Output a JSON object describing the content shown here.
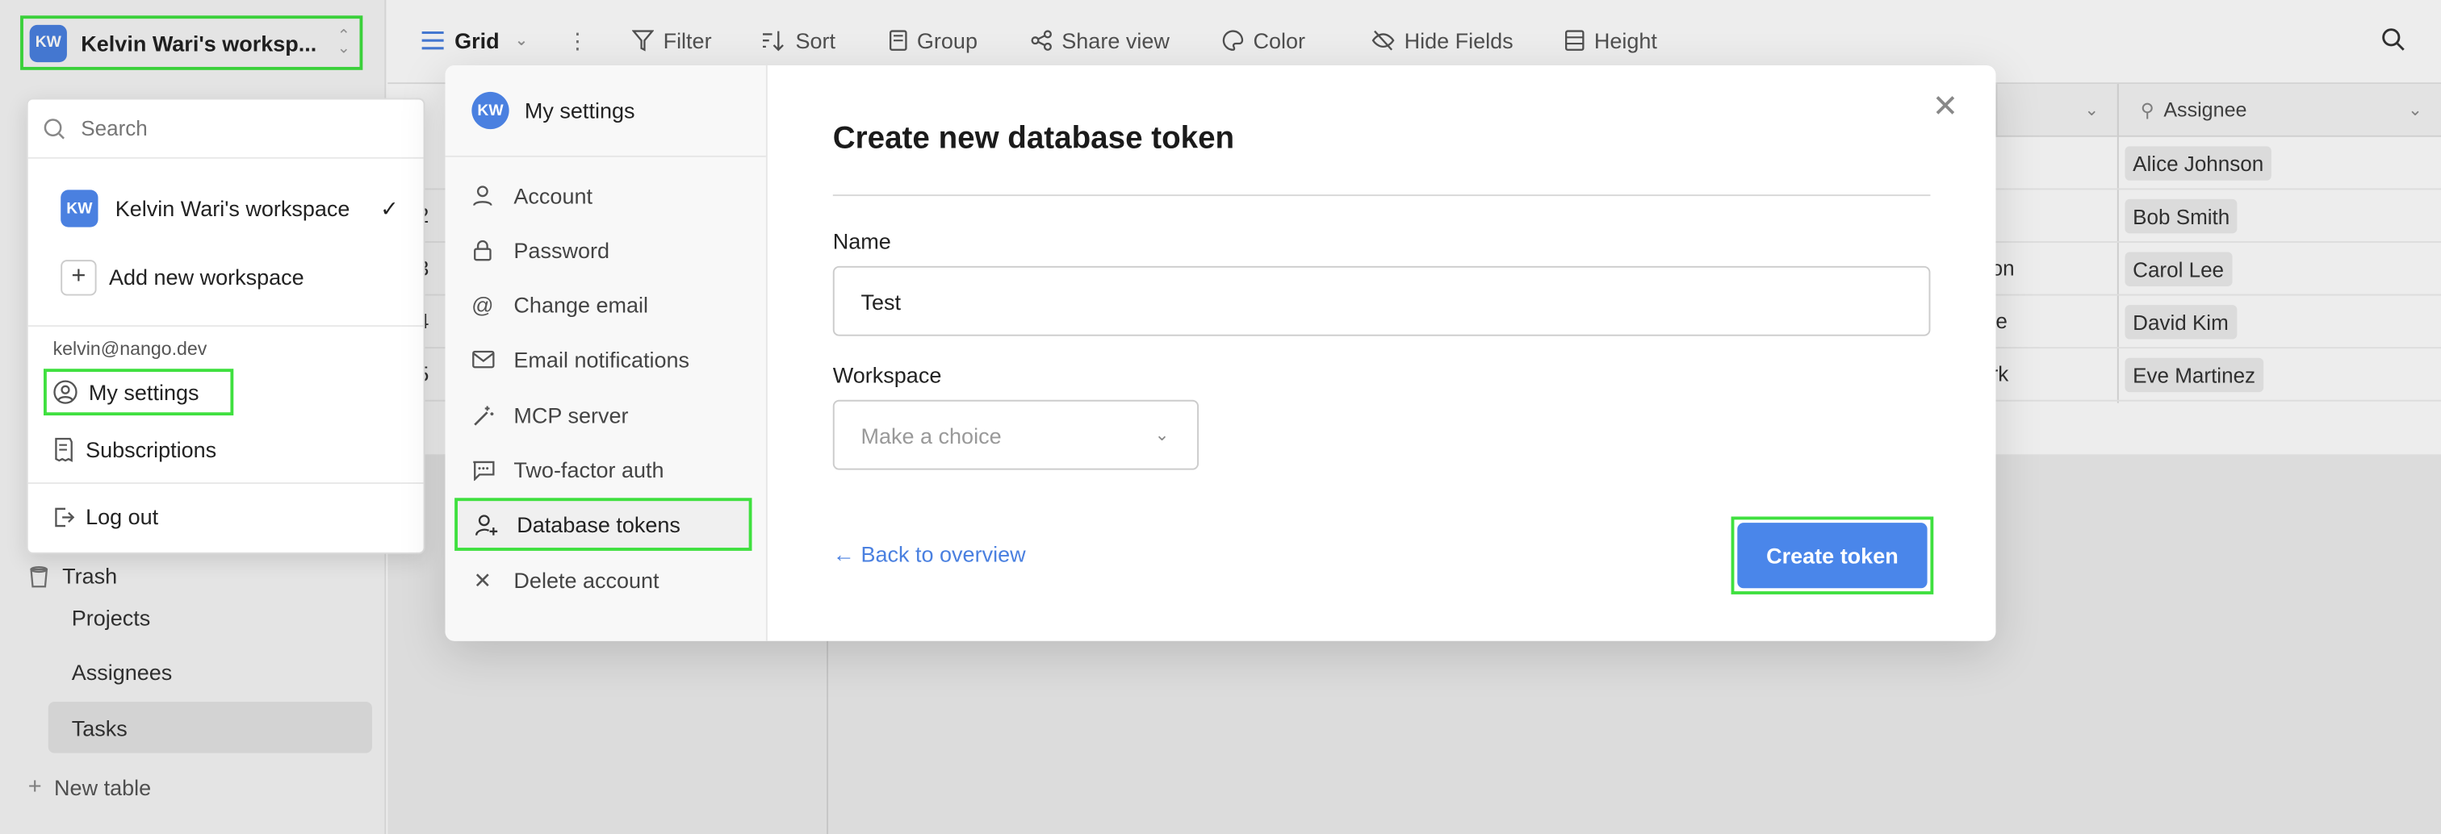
{
  "workspace_switcher": {
    "avatar": "KW",
    "name": "Kelvin Wari's worksp..."
  },
  "toolbar": {
    "view": "Grid",
    "items": [
      "Filter",
      "Sort",
      "Group",
      "Share view",
      "Color",
      "Hide Fields",
      "Height"
    ]
  },
  "grid": {
    "assignee_header": "Assignee",
    "row_numbers": [
      "2",
      "3",
      "4",
      "5"
    ],
    "assignees": [
      "Alice Johnson",
      "Bob Smith",
      "Carol Lee",
      "David Kim",
      "Eve Martinez"
    ],
    "partial_cells": [
      "on",
      "le",
      "rk"
    ]
  },
  "sidebar": {
    "trash": "Trash",
    "tables": [
      "Projects",
      "Assignees",
      "Tasks"
    ],
    "new_table": "New table"
  },
  "dropdown": {
    "search_placeholder": "Search",
    "workspace_avatar": "KW",
    "workspace_name": "Kelvin Wari's workspace",
    "add_workspace": "Add new workspace",
    "email": "kelvin@nango.dev",
    "my_settings": "My settings",
    "subscriptions": "Subscriptions",
    "log_out": "Log out"
  },
  "settings_modal": {
    "avatar": "KW",
    "header": "My settings",
    "menu": [
      "Account",
      "Password",
      "Change email",
      "Email notifications",
      "MCP server",
      "Two-factor auth",
      "Database tokens",
      "Delete account"
    ],
    "title": "Create new database token",
    "name_label": "Name",
    "name_value": "Test",
    "workspace_label": "Workspace",
    "workspace_placeholder": "Make a choice",
    "back_link": "Back to overview",
    "create_button": "Create token"
  },
  "colors": {
    "accent": "#4a86ea",
    "highlight": "#3fe03f"
  }
}
